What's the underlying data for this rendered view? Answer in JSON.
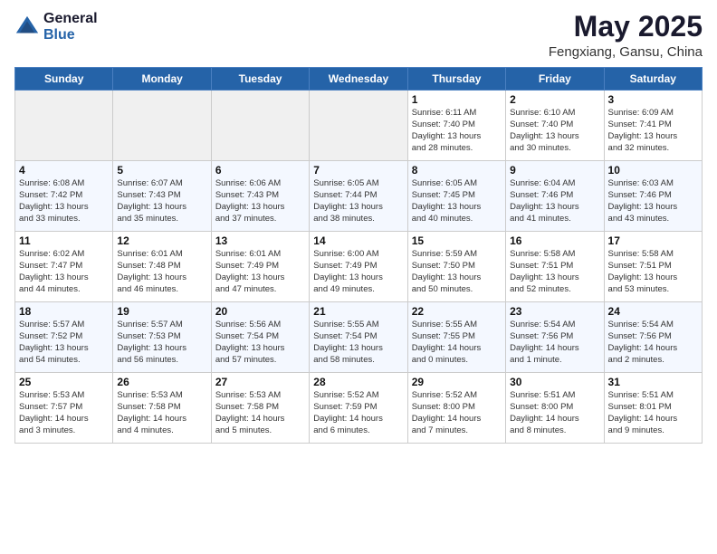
{
  "header": {
    "logo_general": "General",
    "logo_blue": "Blue",
    "month_title": "May 2025",
    "location": "Fengxiang, Gansu, China"
  },
  "days_of_week": [
    "Sunday",
    "Monday",
    "Tuesday",
    "Wednesday",
    "Thursday",
    "Friday",
    "Saturday"
  ],
  "weeks": [
    {
      "days": [
        {
          "date": "",
          "info": ""
        },
        {
          "date": "",
          "info": ""
        },
        {
          "date": "",
          "info": ""
        },
        {
          "date": "",
          "info": ""
        },
        {
          "date": "1",
          "info": "Sunrise: 6:11 AM\nSunset: 7:40 PM\nDaylight: 13 hours\nand 28 minutes."
        },
        {
          "date": "2",
          "info": "Sunrise: 6:10 AM\nSunset: 7:40 PM\nDaylight: 13 hours\nand 30 minutes."
        },
        {
          "date": "3",
          "info": "Sunrise: 6:09 AM\nSunset: 7:41 PM\nDaylight: 13 hours\nand 32 minutes."
        }
      ]
    },
    {
      "days": [
        {
          "date": "4",
          "info": "Sunrise: 6:08 AM\nSunset: 7:42 PM\nDaylight: 13 hours\nand 33 minutes."
        },
        {
          "date": "5",
          "info": "Sunrise: 6:07 AM\nSunset: 7:43 PM\nDaylight: 13 hours\nand 35 minutes."
        },
        {
          "date": "6",
          "info": "Sunrise: 6:06 AM\nSunset: 7:43 PM\nDaylight: 13 hours\nand 37 minutes."
        },
        {
          "date": "7",
          "info": "Sunrise: 6:05 AM\nSunset: 7:44 PM\nDaylight: 13 hours\nand 38 minutes."
        },
        {
          "date": "8",
          "info": "Sunrise: 6:05 AM\nSunset: 7:45 PM\nDaylight: 13 hours\nand 40 minutes."
        },
        {
          "date": "9",
          "info": "Sunrise: 6:04 AM\nSunset: 7:46 PM\nDaylight: 13 hours\nand 41 minutes."
        },
        {
          "date": "10",
          "info": "Sunrise: 6:03 AM\nSunset: 7:46 PM\nDaylight: 13 hours\nand 43 minutes."
        }
      ]
    },
    {
      "days": [
        {
          "date": "11",
          "info": "Sunrise: 6:02 AM\nSunset: 7:47 PM\nDaylight: 13 hours\nand 44 minutes."
        },
        {
          "date": "12",
          "info": "Sunrise: 6:01 AM\nSunset: 7:48 PM\nDaylight: 13 hours\nand 46 minutes."
        },
        {
          "date": "13",
          "info": "Sunrise: 6:01 AM\nSunset: 7:49 PM\nDaylight: 13 hours\nand 47 minutes."
        },
        {
          "date": "14",
          "info": "Sunrise: 6:00 AM\nSunset: 7:49 PM\nDaylight: 13 hours\nand 49 minutes."
        },
        {
          "date": "15",
          "info": "Sunrise: 5:59 AM\nSunset: 7:50 PM\nDaylight: 13 hours\nand 50 minutes."
        },
        {
          "date": "16",
          "info": "Sunrise: 5:58 AM\nSunset: 7:51 PM\nDaylight: 13 hours\nand 52 minutes."
        },
        {
          "date": "17",
          "info": "Sunrise: 5:58 AM\nSunset: 7:51 PM\nDaylight: 13 hours\nand 53 minutes."
        }
      ]
    },
    {
      "days": [
        {
          "date": "18",
          "info": "Sunrise: 5:57 AM\nSunset: 7:52 PM\nDaylight: 13 hours\nand 54 minutes."
        },
        {
          "date": "19",
          "info": "Sunrise: 5:57 AM\nSunset: 7:53 PM\nDaylight: 13 hours\nand 56 minutes."
        },
        {
          "date": "20",
          "info": "Sunrise: 5:56 AM\nSunset: 7:54 PM\nDaylight: 13 hours\nand 57 minutes."
        },
        {
          "date": "21",
          "info": "Sunrise: 5:55 AM\nSunset: 7:54 PM\nDaylight: 13 hours\nand 58 minutes."
        },
        {
          "date": "22",
          "info": "Sunrise: 5:55 AM\nSunset: 7:55 PM\nDaylight: 14 hours\nand 0 minutes."
        },
        {
          "date": "23",
          "info": "Sunrise: 5:54 AM\nSunset: 7:56 PM\nDaylight: 14 hours\nand 1 minute."
        },
        {
          "date": "24",
          "info": "Sunrise: 5:54 AM\nSunset: 7:56 PM\nDaylight: 14 hours\nand 2 minutes."
        }
      ]
    },
    {
      "days": [
        {
          "date": "25",
          "info": "Sunrise: 5:53 AM\nSunset: 7:57 PM\nDaylight: 14 hours\nand 3 minutes."
        },
        {
          "date": "26",
          "info": "Sunrise: 5:53 AM\nSunset: 7:58 PM\nDaylight: 14 hours\nand 4 minutes."
        },
        {
          "date": "27",
          "info": "Sunrise: 5:53 AM\nSunset: 7:58 PM\nDaylight: 14 hours\nand 5 minutes."
        },
        {
          "date": "28",
          "info": "Sunrise: 5:52 AM\nSunset: 7:59 PM\nDaylight: 14 hours\nand 6 minutes."
        },
        {
          "date": "29",
          "info": "Sunrise: 5:52 AM\nSunset: 8:00 PM\nDaylight: 14 hours\nand 7 minutes."
        },
        {
          "date": "30",
          "info": "Sunrise: 5:51 AM\nSunset: 8:00 PM\nDaylight: 14 hours\nand 8 minutes."
        },
        {
          "date": "31",
          "info": "Sunrise: 5:51 AM\nSunset: 8:01 PM\nDaylight: 14 hours\nand 9 minutes."
        }
      ]
    }
  ]
}
